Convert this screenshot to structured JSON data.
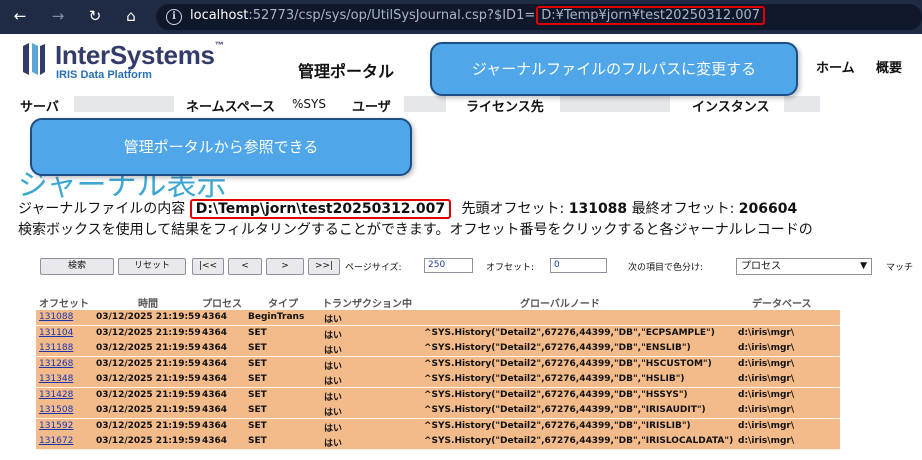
{
  "browser": {
    "back_glyph": "←",
    "forward_glyph": "→",
    "reload_glyph": "↻",
    "home_glyph": "⌂",
    "info_glyph": "i",
    "url_host": "localhost",
    "url_rest": ":52773/csp/sys/op/UtilSysJournal.csp?$ID1=",
    "url_param": "D:¥Temp¥jorn¥test20250312.007"
  },
  "header": {
    "logo_text": "InterSystems",
    "logo_tm": "™",
    "logo_sub": "IRIS Data Platform",
    "portal_title": "管理ポータル",
    "home": "ホーム",
    "about": "概要"
  },
  "infobar": {
    "server_label": "サーバ",
    "namespace_label": "ネームスペース",
    "namespace_value": "%SYS",
    "user_label": "ユーザ",
    "license_label": "ライセンス先",
    "instance_label": "インスタンス"
  },
  "page": {
    "title": "ジャーナル表示",
    "file_label": "ジャーナルファイルの内容",
    "file_path": "D:\\Temp\\jorn\\test20250312.007",
    "first_offset_label": "先頭オフセット:",
    "first_offset": "131088",
    "last_offset_label": "最終オフセット:",
    "last_offset": "206604",
    "hint": "検索ボックスを使用して結果をフィルタリングすることができます。オフセット番号をクリックすると各ジャーナルレコードの"
  },
  "toolbar": {
    "search": "検索",
    "reset": "リセット",
    "first": "|<<",
    "prev": "<",
    "next": ">",
    "last": ">>|",
    "page_size_label": "ページサイズ:",
    "page_size": "250",
    "offset_label": "オフセット:",
    "offset": "0",
    "color_label": "次の項目で色分け:",
    "color_value": "プロセス",
    "match_label": "マッチ"
  },
  "table": {
    "headers": [
      "オフセット",
      "時間",
      "プロセス",
      "タイプ",
      "トランザクション中",
      "グローバルノード",
      "データベース"
    ],
    "rows": [
      [
        "131088",
        "03/12/2025 21:19:59",
        "4364",
        "BeginTrans",
        "はい",
        "",
        ""
      ],
      [
        "131104",
        "03/12/2025 21:19:59",
        "4364",
        "SET",
        "はい",
        "^SYS.History(\"Detail2\",67276,44399,\"DB\",\"ECPSAMPLE\")",
        "d:\\iris\\mgr\\"
      ],
      [
        "131188",
        "03/12/2025 21:19:59",
        "4364",
        "SET",
        "はい",
        "^SYS.History(\"Detail2\",67276,44399,\"DB\",\"ENSLIB\")",
        "d:\\iris\\mgr\\"
      ],
      [
        "131268",
        "03/12/2025 21:19:59",
        "4364",
        "SET",
        "はい",
        "^SYS.History(\"Detail2\",67276,44399,\"DB\",\"HSCUSTOM\")",
        "d:\\iris\\mgr\\"
      ],
      [
        "131348",
        "03/12/2025 21:19:59",
        "4364",
        "SET",
        "はい",
        "^SYS.History(\"Detail2\",67276,44399,\"DB\",\"HSLIB\")",
        "d:\\iris\\mgr\\"
      ],
      [
        "131428",
        "03/12/2025 21:19:59",
        "4364",
        "SET",
        "はい",
        "^SYS.History(\"Detail2\",67276,44399,\"DB\",\"HSSYS\")",
        "d:\\iris\\mgr\\"
      ],
      [
        "131508",
        "03/12/2025 21:19:59",
        "4364",
        "SET",
        "はい",
        "^SYS.History(\"Detail2\",67276,44399,\"DB\",\"IRISAUDIT\")",
        "d:\\iris\\mgr\\"
      ],
      [
        "131592",
        "03/12/2025 21:19:59",
        "4364",
        "SET",
        "はい",
        "^SYS.History(\"Detail2\",67276,44399,\"DB\",\"IRISLIB\")",
        "d:\\iris\\mgr\\"
      ],
      [
        "131672",
        "03/12/2025 21:19:59",
        "4364",
        "SET",
        "はい",
        "^SYS.History(\"Detail2\",67276,44399,\"DB\",\"IRISLOCALDATA\")",
        "d:\\iris\\mgr\\"
      ]
    ]
  },
  "callouts": {
    "top": "ジャーナルファイルのフルパスに変更する",
    "left": "管理ポータルから参照できる"
  },
  "colors": {
    "row_highlight": "#f3bb8a",
    "title": "#3da8d4",
    "callout": "#4fa6e8",
    "emphasis_border": "#e00000"
  }
}
